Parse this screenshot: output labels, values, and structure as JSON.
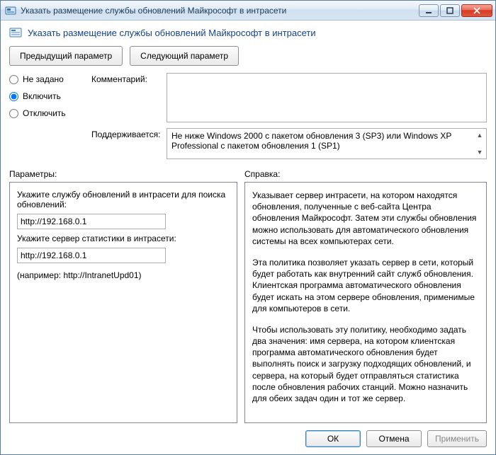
{
  "window": {
    "title": "Указать размещение службы обновлений Майкрософт в интрасети"
  },
  "header": {
    "title": "Указать размещение службы обновлений Майкрософт в интрасети"
  },
  "nav": {
    "prev": "Предыдущий параметр",
    "next": "Следующий параметр"
  },
  "state": {
    "not_configured": "Не задано",
    "enabled": "Включить",
    "disabled": "Отключить",
    "selected": "enabled"
  },
  "labels": {
    "comment": "Комментарий:",
    "supported": "Поддерживается:",
    "params_header": "Параметры:",
    "help_header": "Справка:"
  },
  "supported_text": "Не ниже Windows 2000 с пакетом обновления 3 (SP3) или Windows XP Professional с пакетом обновления 1 (SP1)",
  "params": {
    "update_service_label": "Укажите службу обновлений в интрасети для поиска обновлений:",
    "update_service_value": "http://192.168.0.1",
    "stats_server_label": "Укажите сервер статистики в интрасети:",
    "stats_server_value": "http://192.168.0.1",
    "example": "(например: http://IntranetUpd01)"
  },
  "help": {
    "p1": "Указывает сервер интрасети, на котором находятся обновления, полученные с веб-сайта Центра обновления Майкрософт. Затем эти службы обновления можно использовать для автоматического обновления системы на всех компьютерах сети.",
    "p2": "Эта политика позволяет указать сервер в сети, который будет работать как внутренний сайт служб обновления. Клиентская программа автоматического обновления будет искать на этом сервере обновления, применимые для компьютеров в сети.",
    "p3": "Чтобы использовать эту политику, необходимо задать два значения: имя сервера, на котором клиентская программа автоматического обновления будет выполнять поиск и загрузку подходящих обновлений, и сервера, на который будет отправляться статистика после обновления рабочих станций. Можно назначить для обеих задач один и тот же сервер."
  },
  "footer": {
    "ok": "ОК",
    "cancel": "Отмена",
    "apply": "Применить"
  }
}
